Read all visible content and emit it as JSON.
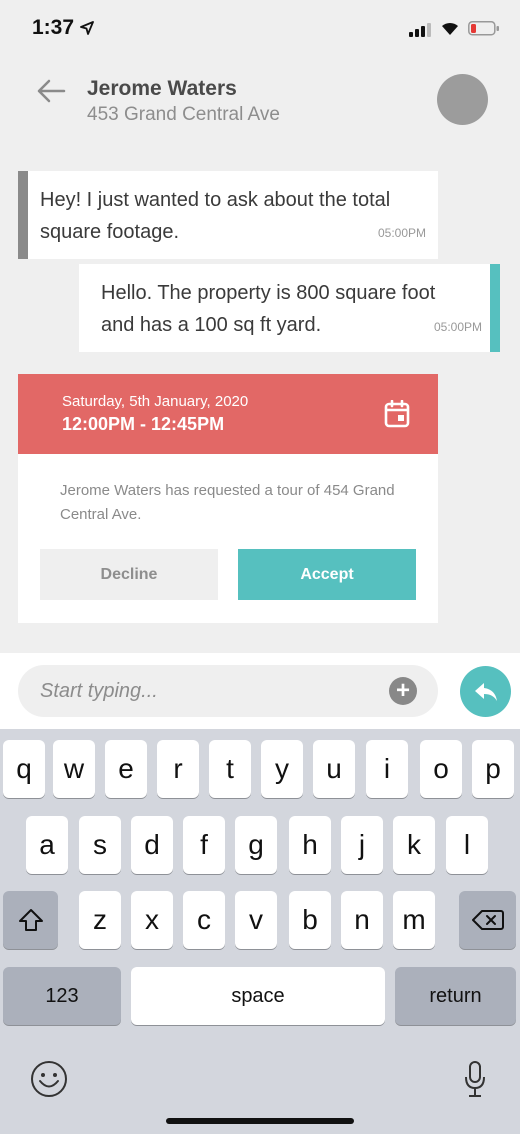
{
  "status_bar": {
    "time": "1:37"
  },
  "header": {
    "name": "Jerome Waters",
    "address": "453 Grand Central Ave"
  },
  "messages": [
    {
      "text": "Hey! I just wanted to ask about the total square footage.",
      "time": "05:00PM",
      "direction": "incoming"
    },
    {
      "text": "Hello. The property is 800 square foot and has a 100 sq ft yard.",
      "time": "05:00PM",
      "direction": "outgoing"
    }
  ],
  "tour_request": {
    "date": "Saturday, 5th January, 2020",
    "time_range": "12:00PM - 12:45PM",
    "text": "Jerome Waters has requested a tour of 454 Grand Central Ave.",
    "decline_label": "Decline",
    "accept_label": "Accept"
  },
  "composer": {
    "placeholder": "Start typing..."
  },
  "keyboard": {
    "row1": [
      "q",
      "w",
      "e",
      "r",
      "t",
      "y",
      "u",
      "i",
      "o",
      "p"
    ],
    "row2": [
      "a",
      "s",
      "d",
      "f",
      "g",
      "h",
      "j",
      "k",
      "l"
    ],
    "row3": [
      "z",
      "x",
      "c",
      "v",
      "b",
      "n",
      "m"
    ],
    "numbers_label": "123",
    "space_label": "space",
    "return_label": "return"
  },
  "colors": {
    "accent": "#56c0bf",
    "tour_header": "#e26866",
    "incoming_bar": "#8a8a8a"
  },
  "icons": [
    "location-arrow-icon",
    "signal-icon",
    "wifi-icon",
    "battery-icon",
    "back-arrow-icon",
    "calendar-icon",
    "plus-icon",
    "reply-icon",
    "shift-icon",
    "delete-icon",
    "emoji-icon",
    "microphone-icon"
  ]
}
